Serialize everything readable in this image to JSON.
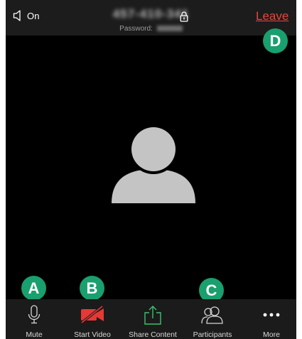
{
  "top_bar": {
    "speaker_label": "On",
    "meeting_id": "457-410-341",
    "password_label": "Password:",
    "leave_label": "Leave"
  },
  "badges": {
    "a": "A",
    "b": "B",
    "c": "C",
    "d": "D"
  },
  "toolbar": {
    "mute": "Mute",
    "start_video": "Start Video",
    "share_content": "Share Content",
    "participants": "Participants",
    "more": "More"
  },
  "colors": {
    "leave": "#e8453c",
    "badge": "#1a9f6f",
    "video_off": "#e53935",
    "share": "#3cc36b"
  },
  "icons": [
    "speaker-icon",
    "lock-icon",
    "microphone-icon",
    "video-off-icon",
    "share-icon",
    "participants-icon",
    "more-icon",
    "avatar-icon"
  ]
}
